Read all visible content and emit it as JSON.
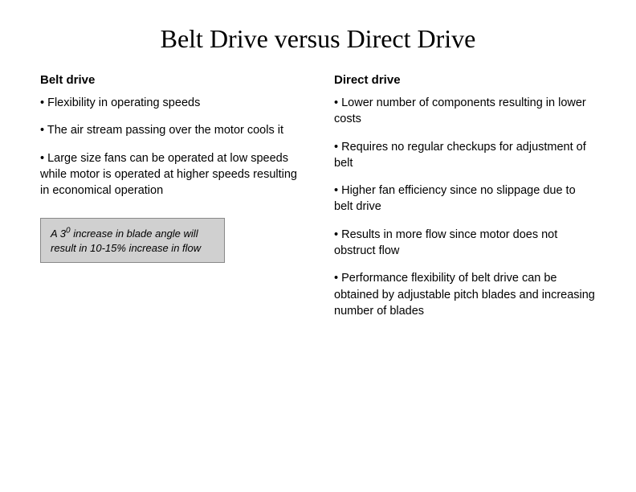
{
  "title": "Belt Drive versus Direct Drive",
  "left_column": {
    "header": "Belt drive",
    "bullets": [
      "• Flexibility in operating speeds",
      "• The air stream passing over the motor cools it",
      "• Large size fans can be operated at low speeds while motor is operated at higher speeds resulting in economical operation"
    ],
    "note": {
      "sup": "0",
      "text": "A 3° increase in blade angle will result in 10-15% increase in flow"
    }
  },
  "right_column": {
    "header": "Direct drive",
    "bullets": [
      "• Lower number of components resulting in lower costs",
      "• Requires no regular checkups for adjustment of belt",
      "• Higher fan efficiency since no slippage due to belt drive",
      "• Results in more flow since motor does not obstruct flow",
      "• Performance flexibility of belt drive can be obtained by adjustable pitch blades and increasing number of blades"
    ]
  }
}
